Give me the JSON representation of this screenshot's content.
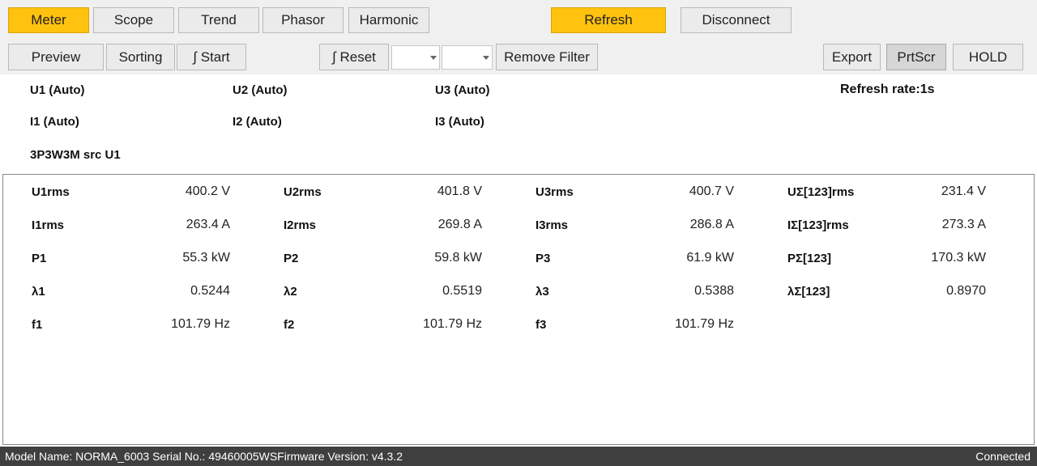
{
  "tabs": {
    "meter": "Meter",
    "scope": "Scope",
    "trend": "Trend",
    "phasor": "Phasor",
    "harmonic": "Harmonic"
  },
  "actions": {
    "refresh": "Refresh",
    "disconnect": "Disconnect",
    "preview": "Preview",
    "sorting": "Sorting",
    "start": "∫ Start",
    "reset": "∫ Reset",
    "remove_filter": "Remove Filter",
    "export": "Export",
    "prtscr": "PrtScr",
    "hold": "HOLD"
  },
  "combos": [
    "",
    ""
  ],
  "info": {
    "u1": "U1 (Auto)",
    "u2": "U2 (Auto)",
    "u3": "U3 (Auto)",
    "i1": "I1 (Auto)",
    "i2": "I2 (Auto)",
    "i3": "I3 (Auto)",
    "wiring": "3P3W3M src U1",
    "refresh_rate": "Refresh rate:1s"
  },
  "measurements": [
    [
      {
        "label": "U1rms",
        "value": "400.2 V"
      },
      {
        "label": "U2rms",
        "value": "401.8 V"
      },
      {
        "label": "U3rms",
        "value": "400.7 V"
      },
      {
        "label": "UΣ[123]rms",
        "value": "231.4 V"
      }
    ],
    [
      {
        "label": "I1rms",
        "value": "263.4 A"
      },
      {
        "label": "I2rms",
        "value": "269.8 A"
      },
      {
        "label": "I3rms",
        "value": "286.8 A"
      },
      {
        "label": "IΣ[123]rms",
        "value": "273.3 A"
      }
    ],
    [
      {
        "label": "P1",
        "value": "55.3 kW"
      },
      {
        "label": "P2",
        "value": "59.8 kW"
      },
      {
        "label": "P3",
        "value": "61.9 kW"
      },
      {
        "label": "PΣ[123]",
        "value": "170.3 kW"
      }
    ],
    [
      {
        "label": "λ1",
        "value": "0.5244"
      },
      {
        "label": "λ2",
        "value": "0.5519"
      },
      {
        "label": "λ3",
        "value": "0.5388"
      },
      {
        "label": "λΣ[123]",
        "value": "0.8970"
      }
    ],
    [
      {
        "label": "f1",
        "value": "101.79 Hz"
      },
      {
        "label": "f2",
        "value": "101.79 Hz"
      },
      {
        "label": "f3",
        "value": "101.79 Hz"
      }
    ]
  ],
  "status": {
    "left": "Model Name:  NORMA_6003 Serial No.:  49460005WSFirmware Version:  v4.3.2",
    "right": "Connected"
  },
  "colors": {
    "accent": "#ffc20e",
    "statusbar": "#3f3f3f"
  }
}
